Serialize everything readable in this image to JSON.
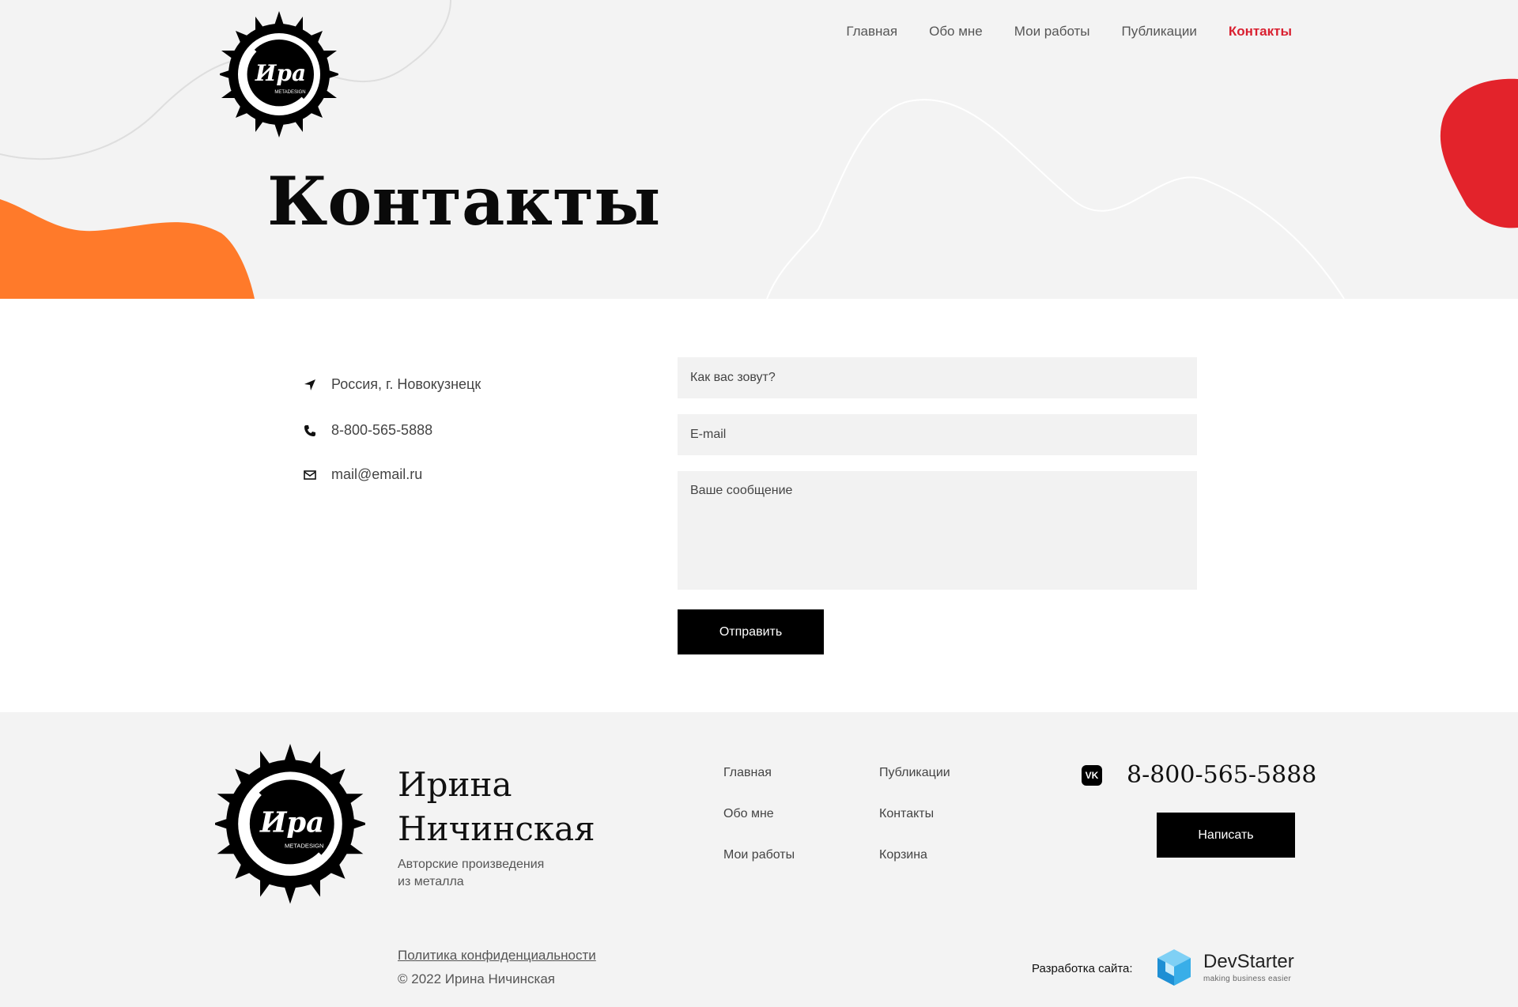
{
  "header": {
    "nav": [
      {
        "label": "Главная"
      },
      {
        "label": "Обо мне"
      },
      {
        "label": "Мои работы"
      },
      {
        "label": "Публикации"
      },
      {
        "label": "Контакты",
        "active": true
      }
    ],
    "title": "Контакты",
    "logo_text": "Ира",
    "logo_sub": "METADESIGN"
  },
  "contacts": {
    "address": "Россия, г. Новокузнецк",
    "phone": "8-800-565-5888",
    "email": "mail@email.ru"
  },
  "form": {
    "name_placeholder": "Как вас зовут?",
    "email_placeholder": "E-mail",
    "message_placeholder": "Ваше сообщение",
    "submit_label": "Отправить"
  },
  "footer": {
    "name_line1": "Ирина",
    "name_line2": "Ничинская",
    "subtitle_line1": "Авторские произведения",
    "subtitle_line2": "из металла",
    "links_col1": [
      "Главная",
      "Обо мне",
      "Мои работы"
    ],
    "links_col2": [
      "Публикации",
      "Контакты",
      "Корзина"
    ],
    "vk_label": "VK",
    "phone": "8-800-565-5888",
    "write_label": "Написать",
    "policy": "Политика конфиденциальности",
    "copyright": "© 2022 Ирина Ничинская",
    "dev_label": "Разработка сайта:",
    "dev_name": "DevStarter",
    "dev_tagline": "making business easier"
  },
  "colors": {
    "accent_red": "#d92030",
    "orange_blob": "#ff7a2a",
    "red_blob": "#e3232b",
    "button_bg": "#000000",
    "field_bg": "#f2f2f2"
  },
  "icons": {
    "address": "navigation-arrow-icon",
    "phone": "phone-icon",
    "email": "mail-icon",
    "vk": "vk-icon"
  }
}
